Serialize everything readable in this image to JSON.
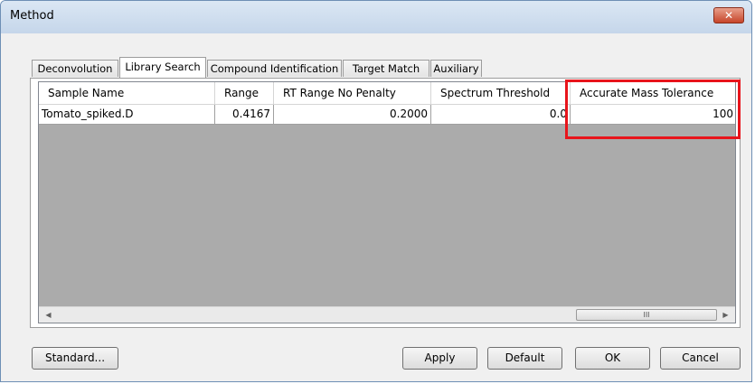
{
  "window": {
    "title": "Method",
    "close_glyph": "✕"
  },
  "tabs": [
    {
      "label": "Deconvolution",
      "active": false
    },
    {
      "label": "Library Search",
      "active": true
    },
    {
      "label": "Compound Identification",
      "active": false
    },
    {
      "label": "Target Match",
      "active": false
    },
    {
      "label": "Auxiliary",
      "active": false
    }
  ],
  "grid": {
    "columns": [
      "Sample Name",
      "Range",
      "RT Range No Penalty",
      "Spectrum Threshold",
      "Accurate Mass Tolerance"
    ],
    "rows": [
      [
        "Tomato_spiked.D",
        "0.4167",
        "0.2000",
        "0.0",
        "100"
      ]
    ],
    "highlighted_column": "Accurate Mass Tolerance",
    "highlight_color": "#e8141b"
  },
  "scrollbar": {
    "left_arrow": "◀",
    "right_arrow": "▶",
    "thumb_grip": "III"
  },
  "buttons": {
    "standard": "Standard...",
    "apply": "Apply",
    "default": "Default",
    "ok": "OK",
    "cancel": "Cancel"
  }
}
